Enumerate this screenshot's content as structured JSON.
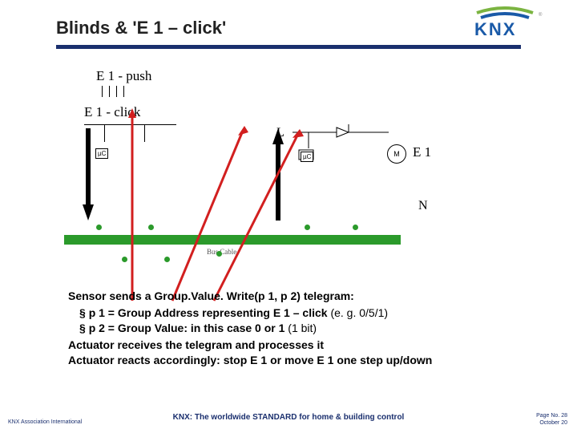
{
  "title": "Blinds & 'E 1 – click'",
  "logo": {
    "brand": "KNX"
  },
  "diagram": {
    "e1_push": "E 1 - push",
    "e1_click": "E 1 - click",
    "L": "L",
    "N": "N",
    "motor_label": "M",
    "e1_motor": "E 1",
    "bus_cable": "Bus Cable",
    "uc": "µC"
  },
  "body": {
    "line1_a": "Sensor sends a ",
    "line1_b": "Group.Value. Write(p 1, p 2) telegram:",
    "li1_a": "p 1 = Group Address representing E 1 – click ",
    "li1_b": "(e. g. 0/5/1)",
    "li2_a": "p 2 = Group Value: in this case 0 or 1 ",
    "li2_b": "(1 bit)",
    "line2": "Actuator receives the telegram and processes it",
    "line3": "Actuator reacts accordingly: stop E 1 or move E 1 one step up/down"
  },
  "footer": {
    "left": "KNX Association International",
    "center": "KNX: The worldwide STANDARD for home & building control",
    "right_page": "Page No. 28",
    "right_date": "October 20"
  }
}
